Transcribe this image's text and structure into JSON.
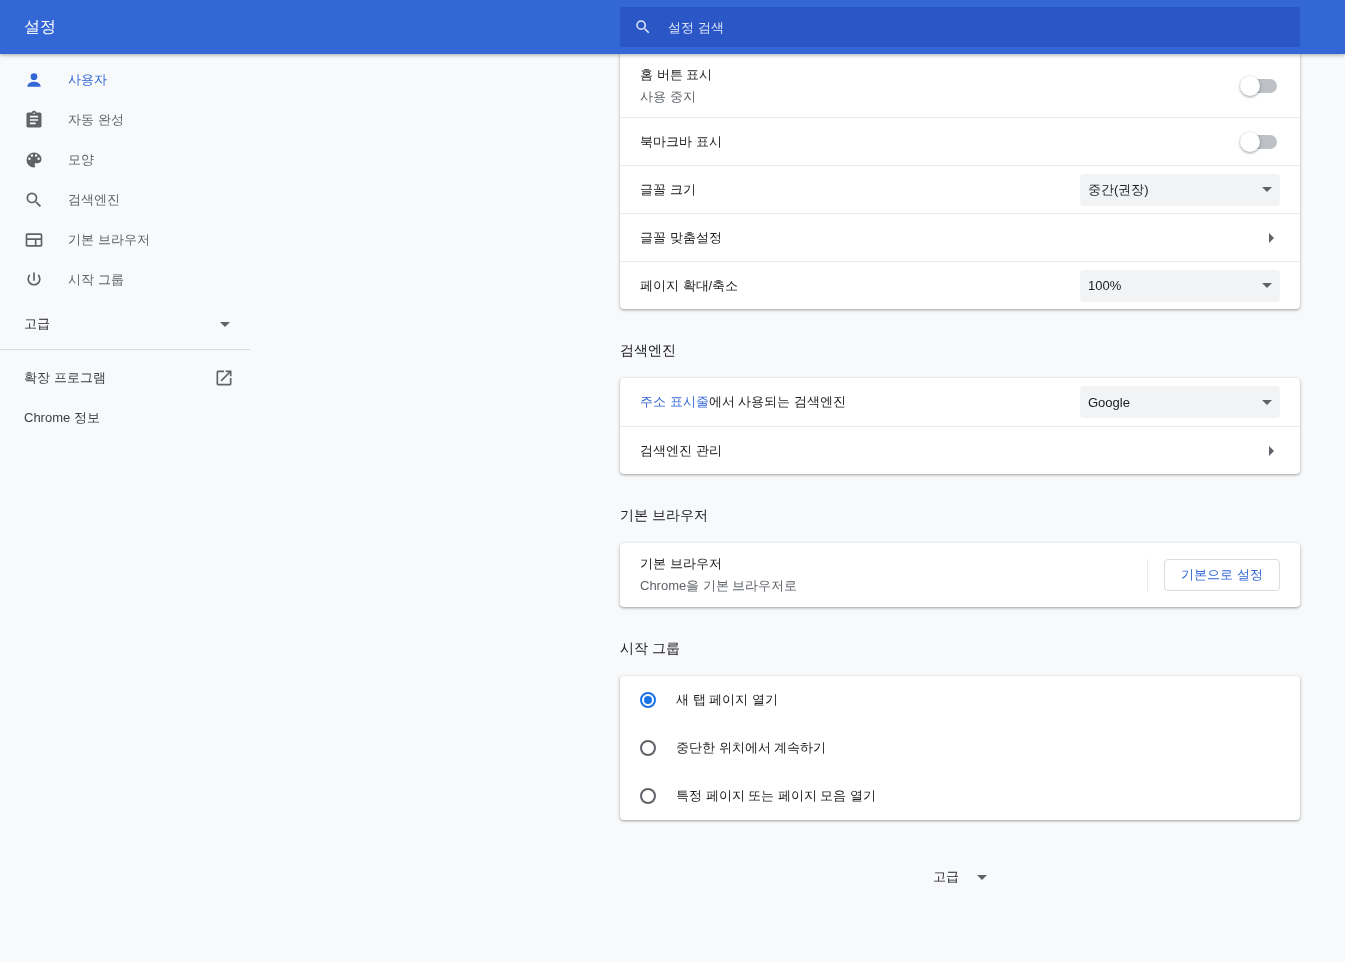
{
  "header": {
    "title": "설정",
    "search": {
      "placeholder": "설정 검색"
    }
  },
  "sidebar": {
    "items": [
      {
        "label": "사용자",
        "selected": true
      },
      {
        "label": "자동 완성",
        "selected": false
      },
      {
        "label": "모양",
        "selected": false
      },
      {
        "label": "검색엔진",
        "selected": false
      },
      {
        "label": "기본 브라우저",
        "selected": false
      },
      {
        "label": "시작 그룹",
        "selected": false
      }
    ],
    "advanced": {
      "label": "고급",
      "expanded": false
    },
    "links": [
      {
        "label": "확장 프로그램",
        "kind": "external"
      },
      {
        "label": "Chrome 정보",
        "kind": "plain"
      }
    ]
  },
  "sections": [
    {
      "rows": [
        {
          "kind": "toggle",
          "label": "홈 버튼 표시",
          "sublabel": "사용 중지",
          "on": false
        },
        {
          "kind": "toggle",
          "label": "북마크바 표시",
          "on": false
        },
        {
          "kind": "select",
          "label": "글꼴 크기",
          "value": "중간(권장)"
        },
        {
          "kind": "arrow",
          "label": "글꼴 맞춤설정"
        },
        {
          "kind": "select",
          "label": "페이지 확대/축소",
          "value": "100%"
        }
      ]
    },
    {
      "title": "검색엔진",
      "rows": [
        {
          "kind": "select",
          "link": "주소 표시줄",
          "label": "에서 사용되는 검색엔진",
          "value": "Google"
        },
        {
          "kind": "arrow",
          "label": "검색엔진 관리"
        }
      ]
    },
    {
      "title": "기본 브라우저",
      "rows": [
        {
          "kind": "button",
          "label": "기본 브라우저",
          "sublabel": "Chrome을 기본 브라우저로",
          "button": "기본으로 설정"
        }
      ]
    },
    {
      "title": "시작 그룹",
      "rows": [
        {
          "kind": "radio",
          "label": "새 탭 페이지 열기",
          "selected": true
        },
        {
          "kind": "radio",
          "label": "중단한 위치에서 계속하기",
          "selected": false
        },
        {
          "kind": "radio",
          "label": "특정 페이지 또는 페이지 모음 열기",
          "selected": false
        }
      ]
    }
  ],
  "advanced": {
    "label": "고급",
    "expanded": false
  }
}
